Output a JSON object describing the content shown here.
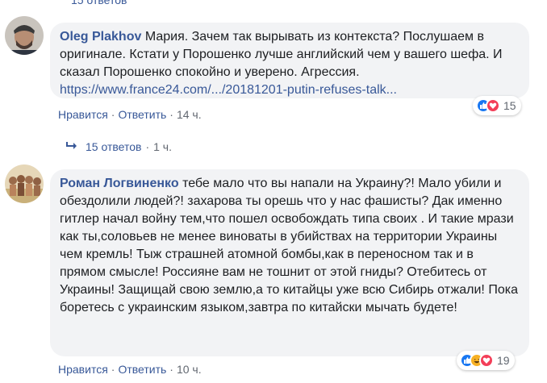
{
  "top_partial": "15 ответов",
  "comment1": {
    "author": "Oleg Plakhov",
    "text": "Мария. Зачем так вырывать из контекста? Послушаем в оригинале. Кстати у Порошенко лучше английский чем у вашего шефа. И сказал Порошенко спокойно и уверено. Агрессия.",
    "link": "https://www.france24.com/.../20181201-putin-refuses-talk...",
    "like": "Нравится",
    "reply": "Ответить",
    "time": "14 ч.",
    "reaction_count": "15"
  },
  "replies": {
    "label": "15 ответов",
    "time": "1 ч."
  },
  "comment2": {
    "author": "Роман Логвиненко",
    "text": "тебе мало что вы напали на Украину?! Мало убили и обездолили людей?! захарова ты орешь что у нас фашисты? Дак именно гитлер начал войну тем,что пошел освобождать типа своих . И такие мрази как ты,соловьев не менее виноваты в убийствах на территории Украины чем кремль! Тыж страшней атомной бомбы,как в переносном так и в прямом смысле! Россияне вам не тошнит от этой гниды? Отебитесь от Украины! Защищай свою землю,а то китайцы уже всю Сибирь отжали! Пока боретесь с украинским языком,завтра по китайски мычать будете!",
    "like": "Нравится",
    "reply": "Ответить",
    "time": "10 ч.",
    "reaction_count": "19"
  },
  "colors": {
    "link": "#385898",
    "bubble": "#f2f3f5",
    "like_blue": "#1877f2",
    "love_red": "#f33e58",
    "haha_yellow": "#f7b125"
  },
  "icons": [
    "reply-arrow-icon",
    "like-reaction-icon",
    "love-reaction-icon",
    "haha-reaction-icon"
  ]
}
